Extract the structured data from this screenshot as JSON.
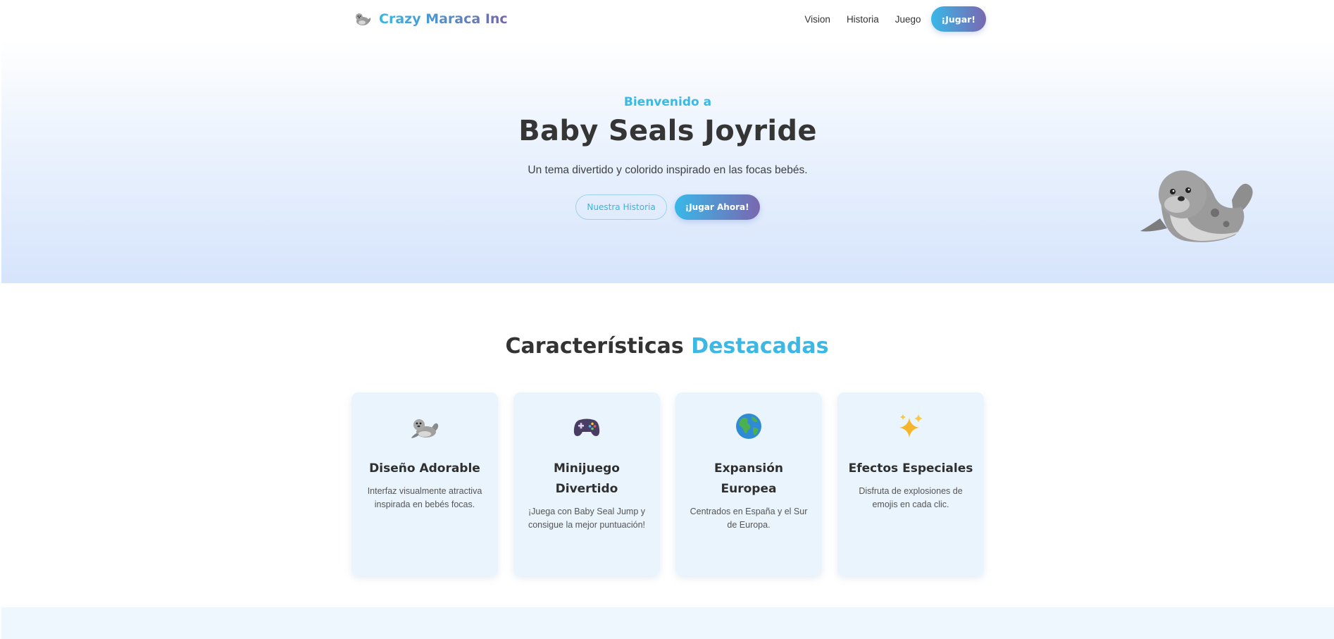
{
  "navbar": {
    "brand_name": "Crazy Maraca Inc",
    "links": [
      "Vision",
      "Historia",
      "Juego"
    ],
    "cta_label": "¡Jugar!"
  },
  "hero": {
    "kicker": "Bienvenido a",
    "title": "Baby Seals Joyride",
    "subtitle": "Un tema divertido y colorido inspirado en las focas bebés.",
    "secondary_button": "Nuestra Historia",
    "primary_button": "¡Jugar Ahora!"
  },
  "features": {
    "title_main": "Características",
    "title_accent": "Destacadas",
    "cards": [
      {
        "icon": "seal-icon",
        "title": "Diseño Adorable",
        "description": "Interfaz visualmente atractiva inspirada en bebés focas."
      },
      {
        "icon": "game-controller-icon",
        "title": "Minijuego Divertido",
        "description": "¡Juega con Baby Seal Jump y consigue la mejor puntuación!"
      },
      {
        "icon": "globe-icon",
        "title": "Expansión Europea",
        "description": "Centrados en España y el Sur de Europa."
      },
      {
        "icon": "sparkles-icon",
        "title": "Efectos Especiales",
        "description": "Disfruta de explosiones de emojis en cada clic."
      }
    ]
  },
  "colors": {
    "accent_blue": "#3bb8e4",
    "accent_purple": "#7a67b0",
    "card_bg": "#e9f4fd",
    "hero_bottom": "#d6e4fc"
  }
}
